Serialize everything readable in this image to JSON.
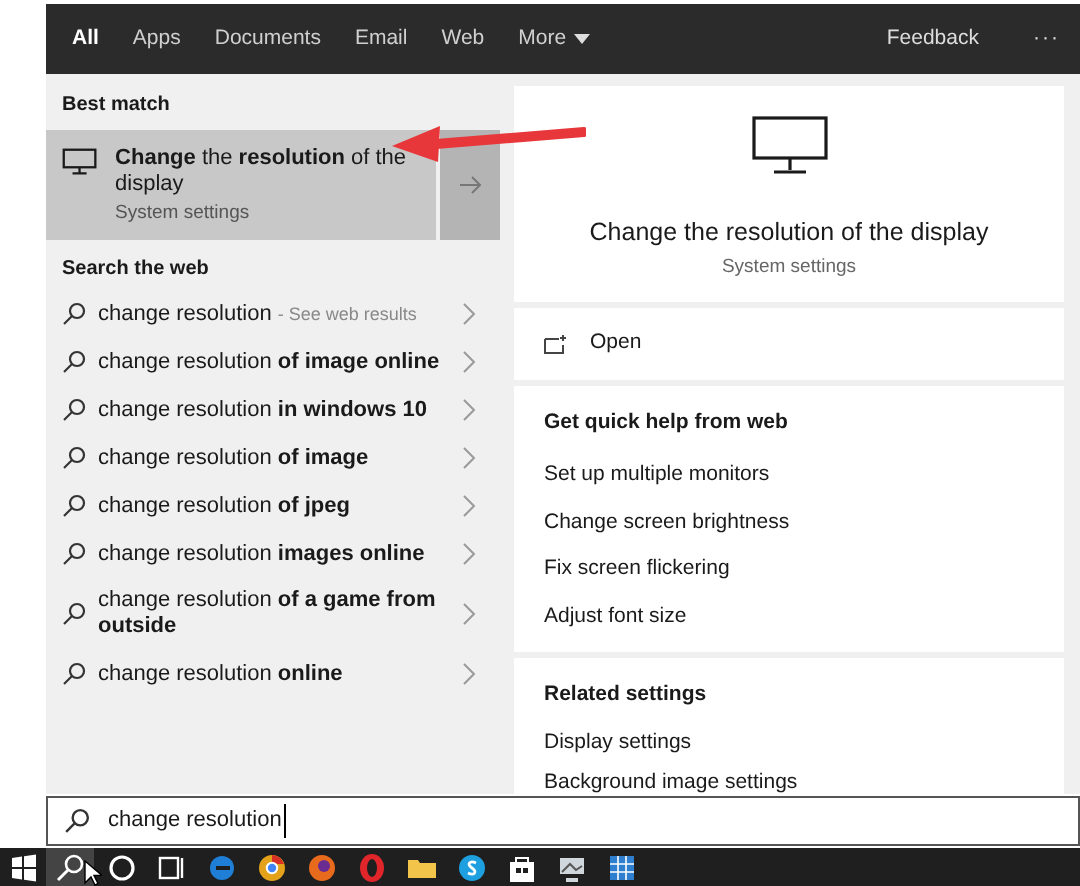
{
  "tabs": [
    {
      "label": "All",
      "selected": true
    },
    {
      "label": "Apps",
      "selected": false
    },
    {
      "label": "Documents",
      "selected": false
    },
    {
      "label": "Email",
      "selected": false
    },
    {
      "label": "Web",
      "selected": false
    },
    {
      "label": "More",
      "selected": false,
      "kind": "dropdown"
    }
  ],
  "feedback": "Feedback",
  "more_options": "···",
  "best_match": {
    "heading": "Best match",
    "title": "**Change** the **resolution** of the display",
    "subtitle": "System settings",
    "selected": true
  },
  "web": {
    "heading": "Search the web",
    "suggestions": [
      {
        "text": "change resolution",
        "hint": "- See web results"
      },
      {
        "text": "change resolution **of image online**"
      },
      {
        "text": "change resolution **in windows 10**"
      },
      {
        "text": "change resolution **of image**"
      },
      {
        "text": "change resolution **of jpeg**"
      },
      {
        "text": "change resolution **images online**"
      },
      {
        "text": "change resolution **of a game from outside**"
      },
      {
        "text": "change resolution **online**"
      }
    ]
  },
  "preview": {
    "title": "Change the resolution of the display",
    "subtitle": "System settings",
    "open": "Open",
    "quick_help": {
      "heading": "Get quick help from web",
      "items": [
        "Set up multiple monitors",
        "Change screen brightness",
        "Fix screen flickering",
        "Adjust font size"
      ]
    },
    "related": {
      "heading": "Related settings",
      "items": [
        "Display settings",
        "Background image settings"
      ]
    }
  },
  "search": {
    "value": "change resolution"
  }
}
